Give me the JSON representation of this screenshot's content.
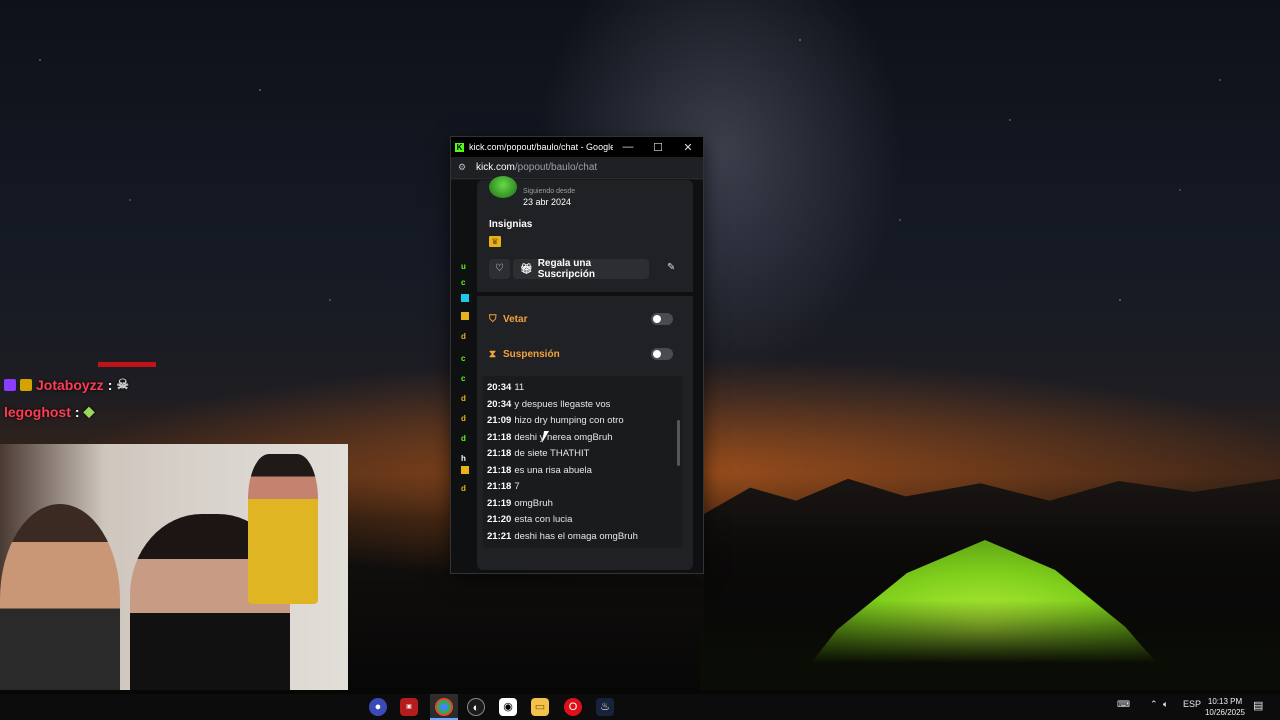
{
  "stream_overlay": {
    "chat_lines": [
      {
        "user": "Jotaboyzz",
        "colon": ":"
      },
      {
        "user": "legoghost",
        "colon": ":"
      }
    ]
  },
  "window": {
    "title": "kick.com/popout/baulo/chat - Google...",
    "url_host": "kick.com",
    "url_path": "/popout/baulo/chat",
    "controls": {
      "minimize": "—",
      "maximize": "☐",
      "close": "✕"
    }
  },
  "user_card": {
    "following_since_label": "Siguiendo desde",
    "following_since_date": "23 abr 2024",
    "badges_title": "Insignias",
    "gift_button_label": "Regala una Suscripción",
    "ban_label": "Vetar",
    "timeout_label": "Suspensión",
    "ban_enabled": false,
    "timeout_enabled": false
  },
  "messages": [
    {
      "time": "20:34",
      "text": "11"
    },
    {
      "time": "20:34",
      "text": "y despues llegaste vos"
    },
    {
      "time": "21:09",
      "text": "hizo dry humping con otro"
    },
    {
      "time": "21:18",
      "text": "deshi y nerea omgBruh"
    },
    {
      "time": "21:18",
      "text": "de siete THATHIT"
    },
    {
      "time": "21:18",
      "text": "es una risa abuela"
    },
    {
      "time": "21:18",
      "text": "7"
    },
    {
      "time": "21:19",
      "text": "omgBruh"
    },
    {
      "time": "21:20",
      "text": "esta con lucia"
    },
    {
      "time": "21:21",
      "text": "deshi has el omaga omgBruh"
    }
  ],
  "taskbar": {
    "language": "ESP",
    "time": "10:13 PM",
    "date": "10/26/2025",
    "icons": [
      "obs-icon",
      "badge-icon",
      "chrome-icon",
      "steam-like-icon",
      "app-icon",
      "folder-icon",
      "opera-icon",
      "steam-icon"
    ]
  }
}
